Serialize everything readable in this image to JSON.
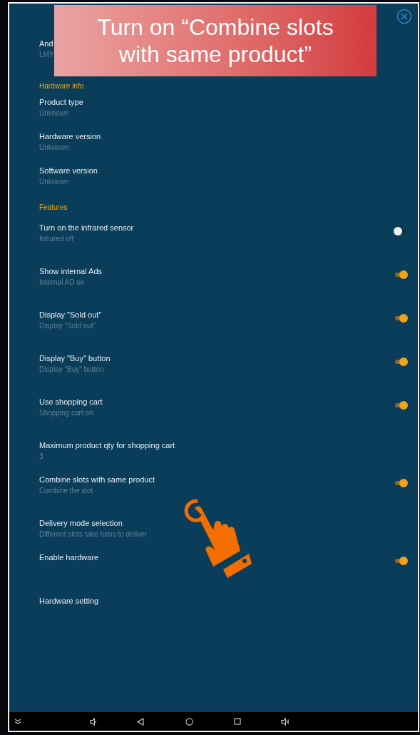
{
  "banner": {
    "lines": [
      "Turn on “Combine slots",
      "with same product”"
    ]
  },
  "sections": [
    {
      "items": [
        {
          "kind": "info",
          "title": "And",
          "subtitle": "LMY"
        }
      ]
    },
    {
      "header": "Hardware info",
      "items": [
        {
          "kind": "info",
          "title": "Product type",
          "subtitle": "Unknown"
        },
        {
          "kind": "info",
          "title": "Hardware version",
          "subtitle": "Unknown"
        },
        {
          "kind": "info",
          "title": "Software version",
          "subtitle": "Unknown"
        }
      ]
    },
    {
      "header": "Features",
      "items": [
        {
          "kind": "toggle",
          "title": "Turn on the infrared sensor",
          "subtitle": "Infrared off",
          "on": false
        },
        {
          "kind": "toggle",
          "title": "Show internal Ads",
          "subtitle": "Internal AD on",
          "on": true
        },
        {
          "kind": "toggle",
          "title": "Display \"Sold out\"",
          "subtitle": "Display \"Sold out\"",
          "on": true
        },
        {
          "kind": "toggle",
          "title": "Display \"Buy\" button",
          "subtitle": "Display \"Buy\" button",
          "on": true
        },
        {
          "kind": "toggle",
          "title": "Use shopping cart",
          "subtitle": "Shopping cart on",
          "on": true
        },
        {
          "kind": "info",
          "title": "Maximum product qty for shopping cart",
          "subtitle": "3"
        },
        {
          "kind": "toggle",
          "title": "Combine slots with same product",
          "subtitle": "Combine the slot",
          "on": true
        },
        {
          "kind": "info",
          "title": "Delivery mode selection",
          "subtitle": "Different slots take turns to deliver"
        },
        {
          "kind": "toggle",
          "title": "Enable hardware",
          "on": true
        },
        {
          "kind": "info",
          "title": "Hardware setting"
        }
      ]
    }
  ]
}
